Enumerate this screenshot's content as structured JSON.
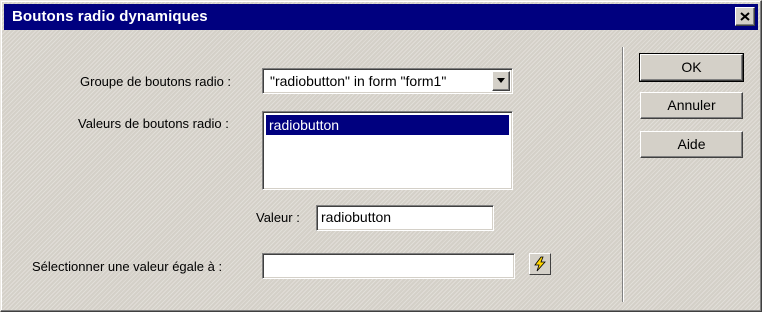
{
  "dialog": {
    "title": "Boutons radio dynamiques"
  },
  "form": {
    "group_label": "Groupe de boutons radio :",
    "group_value": "\"radiobutton\" in form \"form1\"",
    "values_label": "Valeurs de boutons radio :",
    "values_items": [
      "radiobutton"
    ],
    "value_label": "Valeur :",
    "value_field": "radiobutton",
    "select_label": "Sélectionner une valeur égale à :",
    "select_field": ""
  },
  "buttons": {
    "ok": "OK",
    "cancel": "Annuler",
    "help": "Aide"
  },
  "icons": {
    "close": "close-icon",
    "dropdown": "chevron-down-icon",
    "dynamic_data": "lightning-bolt-icon"
  }
}
